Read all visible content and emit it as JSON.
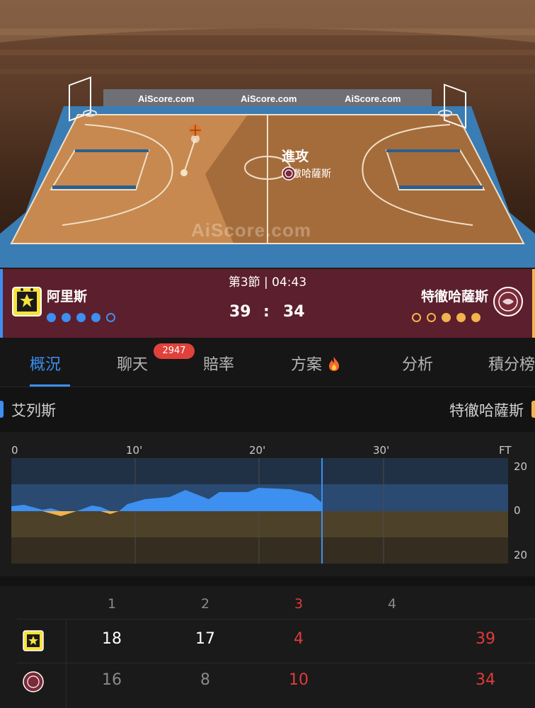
{
  "arena": {
    "ads": [
      "AiScore.com",
      "AiScore.com",
      "AiScore.com"
    ],
    "watermark": "AiScore.com",
    "attack_label": "進攻",
    "attack_team": "特徹哈薩斯"
  },
  "match": {
    "period": "第3節 | 04:43",
    "home": {
      "name": "阿里斯",
      "score": "39",
      "fouls_filled": 4,
      "fouls_total": 5
    },
    "away": {
      "name": "特徹哈薩斯",
      "score": "34",
      "fouls_filled": 3,
      "fouls_total": 5
    },
    "separator": ":"
  },
  "tabs": [
    {
      "label": "概況",
      "active": true
    },
    {
      "label": "聊天",
      "badge": "2947"
    },
    {
      "label": "賠率"
    },
    {
      "label": "方案",
      "icon": "fire-icon"
    },
    {
      "label": "分析"
    },
    {
      "label": "積分榜"
    }
  ],
  "legend": {
    "home": "艾列斯",
    "away": "特徹哈薩斯"
  },
  "momentum": {
    "x_ticks": [
      "0",
      "10'",
      "20'",
      "30'",
      "FT"
    ],
    "y_ticks": [
      "20",
      "0",
      "20"
    ],
    "current_minute": 25
  },
  "quarters": {
    "headers": [
      "1",
      "2",
      "3",
      "4"
    ],
    "current_index": 2,
    "home": [
      "18",
      "17",
      "4",
      ""
    ],
    "away": [
      "16",
      "8",
      "10",
      ""
    ],
    "home_total": "39",
    "away_total": "34"
  },
  "colors": {
    "home": "#3d8ff0",
    "away": "#f3b34c",
    "scorebar": "#5c1f2d",
    "highlight": "#e03b3b"
  }
}
